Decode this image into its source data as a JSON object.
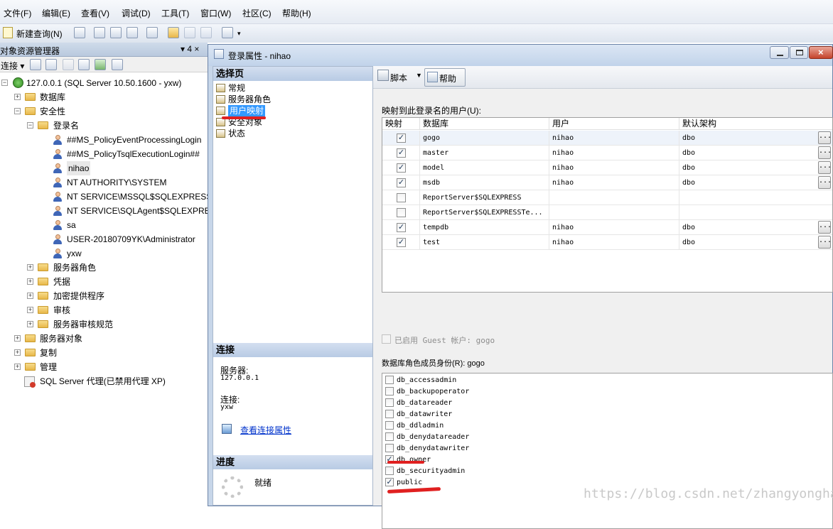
{
  "menu": [
    "文件(F)",
    "编辑(E)",
    "查看(V)",
    "调试(D)",
    "工具(T)",
    "窗口(W)",
    "社区(C)",
    "帮助(H)"
  ],
  "toolbar": {
    "new_query": "新建查询(N)"
  },
  "object_explorer": {
    "title": "对象资源管理器",
    "pin": "▾ 4 ×",
    "connect": "连接 ▾"
  },
  "tree": {
    "server": "127.0.0.1 (SQL Server 10.50.1600 - yxw)",
    "databases": "数据库",
    "security": "安全性",
    "logins": "登录名",
    "login_items": [
      "##MS_PolicyEventProcessingLogin",
      "##MS_PolicyTsqlExecutionLogin##",
      "nihao",
      "NT AUTHORITY\\SYSTEM",
      "NT SERVICE\\MSSQL$SQLEXPRESS",
      "NT SERVICE\\SQLAgent$SQLEXPRE",
      "sa",
      "USER-20180709YK\\Administrator",
      "yxw"
    ],
    "security_items": [
      "服务器角色",
      "凭据",
      "加密提供程序",
      "审核",
      "服务器审核规范"
    ],
    "top_items": [
      "服务器对象",
      "复制",
      "管理"
    ],
    "agent": "SQL Server 代理(已禁用代理 XP)"
  },
  "dialog": {
    "title": "登录属性 - nihao",
    "select_page": "选择页",
    "pages": [
      "常规",
      "服务器角色",
      "用户映射",
      "安全对象",
      "状态"
    ],
    "connection_head": "连接",
    "server_label": "服务器:",
    "server_value": "127.0.0.1",
    "conn_label": "连接:",
    "conn_value": "yxw",
    "view_conn": "查看连接属性",
    "progress_head": "进度",
    "progress_status": "就绪",
    "script": "脚本",
    "help": "帮助",
    "mapped_label": "映射到此登录名的用户(U):",
    "columns": [
      "映射",
      "数据库",
      "用户",
      "默认架构"
    ],
    "rows": [
      {
        "checked": true,
        "db": "gogo",
        "user": "nihao",
        "schema": "dbo"
      },
      {
        "checked": true,
        "db": "master",
        "user": "nihao",
        "schema": "dbo"
      },
      {
        "checked": true,
        "db": "model",
        "user": "nihao",
        "schema": "dbo"
      },
      {
        "checked": true,
        "db": "msdb",
        "user": "nihao",
        "schema": "dbo"
      },
      {
        "checked": false,
        "db": "ReportServer$SQLEXPRESS",
        "user": "",
        "schema": ""
      },
      {
        "checked": false,
        "db": "ReportServer$SQLEXPRESSTe...",
        "user": "",
        "schema": ""
      },
      {
        "checked": true,
        "db": "tempdb",
        "user": "nihao",
        "schema": "dbo"
      },
      {
        "checked": true,
        "db": "test",
        "user": "nihao",
        "schema": "dbo"
      }
    ],
    "guest_label": "已启用 Guest 帐户: gogo",
    "roles_label": "数据库角色成员身份(R): gogo",
    "roles": [
      {
        "name": "db_accessadmin",
        "checked": false
      },
      {
        "name": "db_backupoperator",
        "checked": false
      },
      {
        "name": "db_datareader",
        "checked": false
      },
      {
        "name": "db_datawriter",
        "checked": false
      },
      {
        "name": "db_ddladmin",
        "checked": false
      },
      {
        "name": "db_denydatareader",
        "checked": false
      },
      {
        "name": "db_denydatawriter",
        "checked": false
      },
      {
        "name": "db_owner",
        "checked": true
      },
      {
        "name": "db_securityadmin",
        "checked": false
      },
      {
        "name": "public",
        "checked": true
      }
    ]
  },
  "watermark": "https://blog.csdn.net/zhangyonghan",
  "colors": {
    "highlight": "#3399ff",
    "annotation": "#e02020",
    "link": "#0033cc"
  }
}
